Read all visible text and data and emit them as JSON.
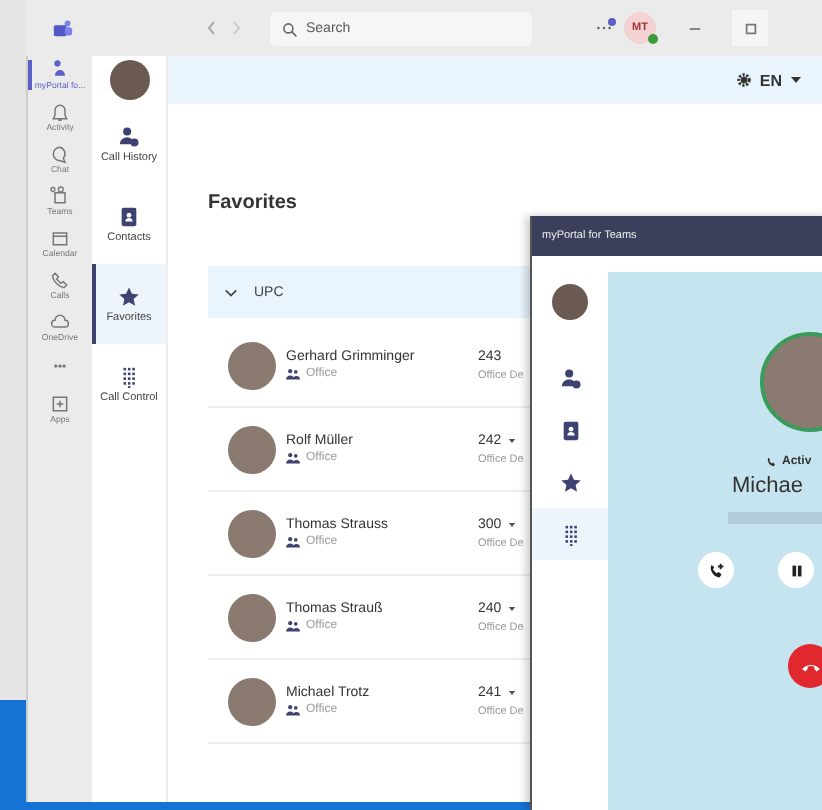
{
  "titlebar": {
    "search": {
      "placeholder": "Search"
    },
    "avatar_initials": "MT",
    "notification": true
  },
  "teams_rail": [
    {
      "kind": "app",
      "label": "myPortal fo...",
      "selected": true
    },
    {
      "kind": "bell",
      "label": "Activity",
      "selected": false
    },
    {
      "kind": "chat",
      "label": "Chat",
      "selected": false
    },
    {
      "kind": "teams",
      "label": "Teams",
      "selected": false
    },
    {
      "kind": "calendar",
      "label": "Calendar",
      "selected": false
    },
    {
      "kind": "phone",
      "label": "Calls",
      "selected": false
    },
    {
      "kind": "cloud",
      "label": "OneDrive",
      "selected": false
    },
    {
      "kind": "more",
      "label": "•••",
      "selected": false
    },
    {
      "kind": "apps",
      "label": "Apps",
      "selected": false
    }
  ],
  "app_nav": [
    {
      "kind": "history",
      "label": "Call History",
      "selected": false
    },
    {
      "kind": "contacts",
      "label": "Contacts",
      "selected": false
    },
    {
      "kind": "favorites",
      "label": "Favorites",
      "selected": true
    },
    {
      "kind": "dialpad",
      "label": "Call Control",
      "selected": false
    }
  ],
  "header": {
    "language": "EN"
  },
  "favorites": {
    "title": "Favorites",
    "group": {
      "name": "UPC",
      "expanded": true
    },
    "contacts": [
      {
        "name": "Gerhard Grimminger",
        "status": "Office",
        "extension": "243",
        "has_menu": false,
        "device": "Office De"
      },
      {
        "name": "Rolf Müller",
        "status": "Office",
        "extension": "242",
        "has_menu": true,
        "device": "Office De"
      },
      {
        "name": "Thomas Strauss",
        "status": "Office",
        "extension": "300",
        "has_menu": true,
        "device": "Office De"
      },
      {
        "name": "Thomas Strauß",
        "status": "Office",
        "extension": "240",
        "has_menu": true,
        "device": "Office De"
      },
      {
        "name": "Michael Trotz",
        "status": "Office",
        "extension": "241",
        "has_menu": true,
        "device": "Office De"
      }
    ]
  },
  "popup": {
    "title": "myPortal for Teams",
    "nav": [
      {
        "kind": "history",
        "selected": false
      },
      {
        "kind": "contacts",
        "selected": false
      },
      {
        "kind": "favorites",
        "selected": false
      },
      {
        "kind": "dialpad",
        "selected": true
      }
    ],
    "call": {
      "state": "Activ",
      "name": "Michae",
      "number_hidden": true
    }
  }
}
